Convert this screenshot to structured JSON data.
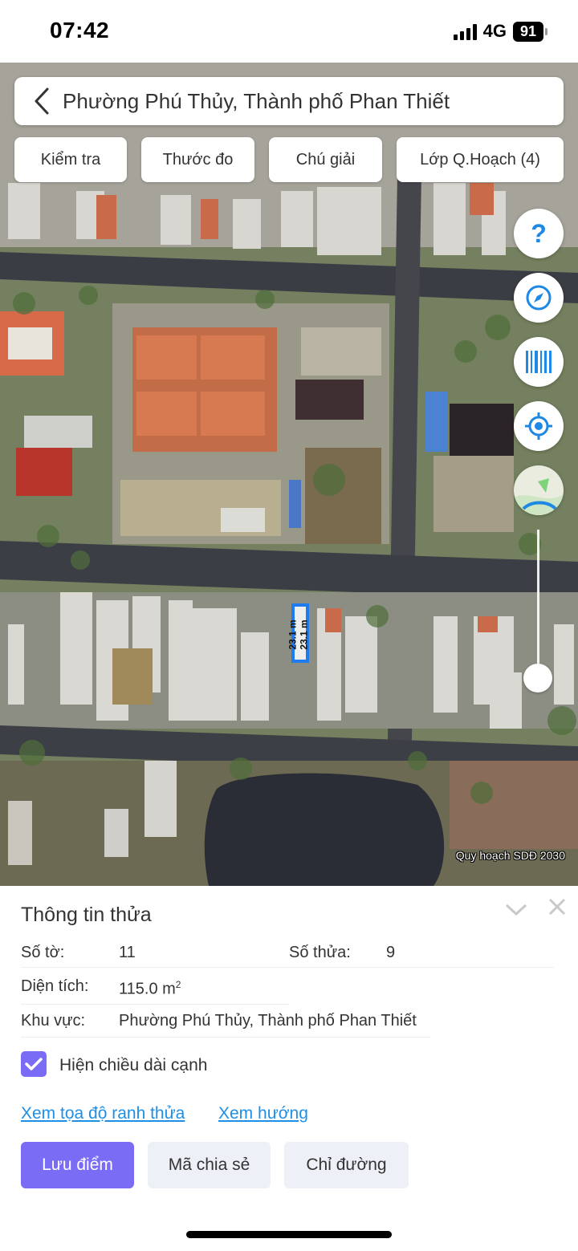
{
  "status_bar": {
    "time": "07:42",
    "network": "4G",
    "battery": "91"
  },
  "search": {
    "title": "Phường Phú Thủy, Thành phố Phan Thiết"
  },
  "toolbar": {
    "items": [
      "Kiểm tra",
      "Thước đo",
      "Chú giải",
      "Lớp Q.Hoạch (4)"
    ]
  },
  "map": {
    "plot_edge_labels": [
      "23.1 m",
      "23.1 m"
    ],
    "overlay_label": "Quy hoạch SDĐ 2030"
  },
  "panel": {
    "title": "Thông tin thửa",
    "so_to_label": "Số tờ:",
    "so_to_value": "11",
    "so_thua_label": "Số thửa:",
    "so_thua_value": "9",
    "dien_tich_label": "Diện tích:",
    "dien_tich_value": "115.0 m",
    "dien_tich_unit_sup": "2",
    "khu_vuc_label": "Khu vực:",
    "khu_vuc_value": "Phường Phú Thủy, Thành phố Phan Thiết",
    "checkbox_label": "Hiện chiều dài cạnh",
    "checkbox_checked": true,
    "link_coordinates": "Xem tọa độ ranh thửa",
    "link_direction": "Xem hướng",
    "btn_save": "Lưu điểm",
    "btn_share": "Mã chia sẻ",
    "btn_directions": "Chỉ đường"
  },
  "colors": {
    "accent": "#7b6cf6",
    "link": "#1f8fe6",
    "fab_icon": "#1e88e5",
    "plot_border": "#1e7cf0"
  }
}
